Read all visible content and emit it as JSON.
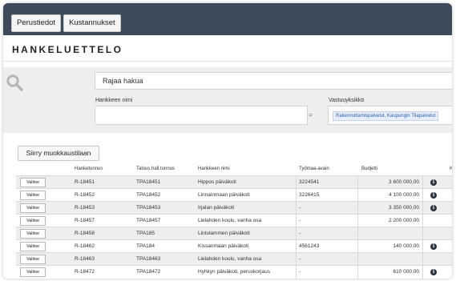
{
  "colors": {
    "topbar": "#3d4a5c",
    "filter_bg": "#eeeeee",
    "chip_text": "#2a62b4",
    "alt_row": "#eeeeee"
  },
  "tabs": [
    {
      "label": "Perustiedot"
    },
    {
      "label": "Kustannukset"
    }
  ],
  "page_title": "HANKELUETTELO",
  "filters": {
    "search_icon": "search-icon",
    "search_placeholder": "Rajaa hakua",
    "name_label": "Hankkeen nimi",
    "name_value": "",
    "operator": "=",
    "unit_label": "Vastuuyksikkö",
    "unit_chip": "Rakennuttamispalvelut, Kaupungin Tilapalvelut"
  },
  "edit_button": "Siirry muokkaustilaan",
  "table": {
    "headers": [
      "Hanketunnus",
      "Talous.hall.tunnus",
      "Hankkeen nimi",
      "Työmaa-avain",
      "Budjetti",
      "Ka"
    ],
    "select_label": "Valitse",
    "info_icon": "info-icon",
    "rows": [
      {
        "id": "R-18451",
        "fin": "TPA18451",
        "name": "Hippos päiväkoti",
        "site": "3224541",
        "budget": "3 600 000,00",
        "info": true
      },
      {
        "id": "R-18452",
        "fin": "TPA18452",
        "name": "Linnainmaan päiväkoti",
        "site": "3226415",
        "budget": "4 100 000,00",
        "info": true
      },
      {
        "id": "R-18453",
        "fin": "TPA18453",
        "name": "Irjalan päiväkoti",
        "site": "-",
        "budget": "3 350 000,00",
        "info": true
      },
      {
        "id": "R-18457",
        "fin": "TPA18457",
        "name": "Lielahden koulu, vanha osa",
        "site": "-",
        "budget": "2 200 000,00",
        "info": false
      },
      {
        "id": "R-18458",
        "fin": "TPA185",
        "name": "Lintulammen päiväkoti",
        "site": "-",
        "budget": "",
        "info": false
      },
      {
        "id": "R-18462",
        "fin": "TPA184",
        "name": "Kissanmaan päiväkoti",
        "site": "4561243",
        "budget": "140 000,00",
        "info": true
      },
      {
        "id": "R-18463",
        "fin": "TPA18463",
        "name": "Lielahden koulu, vanha osa",
        "site": "-",
        "budget": "",
        "info": false
      },
      {
        "id": "R-18472",
        "fin": "TPA18472",
        "name": "Hyhkyn päiväkoti, peruskorjaus",
        "site": "-",
        "budget": "610 000,00",
        "info": true
      }
    ]
  }
}
